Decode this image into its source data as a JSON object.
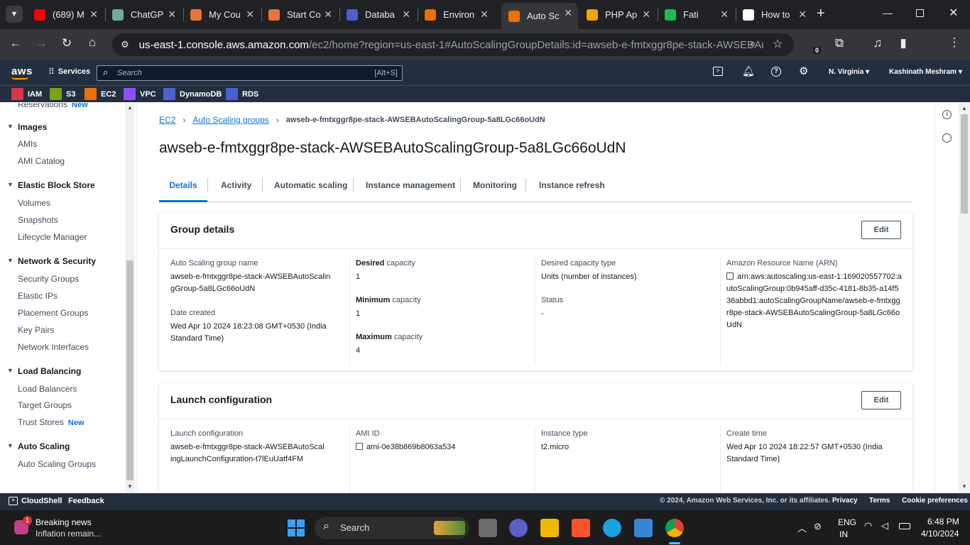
{
  "browser": {
    "tabs": [
      {
        "label": "(689) M",
        "icon": "youtube-icon",
        "color": "#ff0000"
      },
      {
        "label": "ChatGP",
        "icon": "chatgpt-icon",
        "color": "#74aa9c"
      },
      {
        "label": "My Cou",
        "icon": "course-icon",
        "color": "#e8743b"
      },
      {
        "label": "Start Co",
        "icon": "course-icon",
        "color": "#e8743b"
      },
      {
        "label": "Databa",
        "icon": "database-icon",
        "color": "#4b61d1"
      },
      {
        "label": "Environ",
        "icon": "aws-beanstalk-icon",
        "color": "#ed7100"
      },
      {
        "label": "Auto Sc",
        "icon": "aws-ec2-icon",
        "color": "#ed7100"
      },
      {
        "label": "PHP Ap",
        "icon": "package-icon",
        "color": "#f0a30a"
      },
      {
        "label": "Fati",
        "icon": "spotify-icon",
        "color": "#1db954"
      },
      {
        "label": "How to",
        "icon": "medium-icon",
        "color": "#ffffff"
      }
    ],
    "url_host": "us-east-1.console.aws.amazon.com",
    "url_path": "/ec2/home?region=us-east-1#AutoScalingGroupDetails:id=awseb-e-fmtxggr8pe-stack-AWSEBAutoSc...",
    "extensions_badge": "0"
  },
  "aws": {
    "logo": "aws",
    "services_label": "Services",
    "search_placeholder": "Search",
    "search_shortcut": "[Alt+S]",
    "region": "N. Virginia",
    "user": "Kashinath Meshram",
    "favorites": [
      {
        "label": "IAM",
        "color": "#dd344c"
      },
      {
        "label": "S3",
        "color": "#7aa116"
      },
      {
        "label": "EC2",
        "color": "#ed7100"
      },
      {
        "label": "VPC",
        "color": "#8c4fff"
      },
      {
        "label": "DynamoDB",
        "color": "#4b61d1"
      },
      {
        "label": "RDS",
        "color": "#4b61d1"
      }
    ]
  },
  "sidebar": {
    "partial_item": "Reservations",
    "partial_new": "New",
    "sections": [
      {
        "title": "Images",
        "items": [
          "AMIs",
          "AMI Catalog"
        ]
      },
      {
        "title": "Elastic Block Store",
        "items": [
          "Volumes",
          "Snapshots",
          "Lifecycle Manager"
        ]
      },
      {
        "title": "Network & Security",
        "items": [
          "Security Groups",
          "Elastic IPs",
          "Placement Groups",
          "Key Pairs",
          "Network Interfaces"
        ]
      },
      {
        "title": "Load Balancing",
        "items": [
          "Load Balancers",
          "Target Groups",
          "Trust Stores"
        ]
      },
      {
        "title": "Auto Scaling",
        "items": [
          "Auto Scaling Groups"
        ]
      }
    ],
    "new_badge": "New"
  },
  "breadcrumb": {
    "ec2": "EC2",
    "asg": "Auto Scaling groups",
    "current": "awseb-e-fmtxggr8pe-stack-AWSEBAutoScalingGroup-5a8LGc66oUdN"
  },
  "page_title": "awseb-e-fmtxggr8pe-stack-AWSEBAutoScalingGroup-5a8LGc66oUdN",
  "tabs": [
    "Details",
    "Activity",
    "Automatic scaling",
    "Instance management",
    "Monitoring",
    "Instance refresh"
  ],
  "group_details": {
    "title": "Group details",
    "edit": "Edit",
    "name_label": "Auto Scaling group name",
    "name_value": "awseb-e-fmtxggr8pe-stack-AWSEBAutoScalingGroup-5a8LGc66oUdN",
    "date_label": "Date created",
    "date_value": "Wed Apr 10 2024 18:23:08 GMT+0530 (India Standard Time)",
    "desired_bold": "Desired",
    "capacity_word": "capacity",
    "desired_value": "1",
    "minimum_bold": "Minimum",
    "minimum_value": "1",
    "maximum_bold": "Maximum",
    "maximum_value": "4",
    "type_label": "Desired capacity type",
    "type_value": "Units (number of instances)",
    "status_label": "Status",
    "status_value": "-",
    "arn_label": "Amazon Resource Name (ARN)",
    "arn_value": "arn:aws:autoscaling:us-east-1:169020557702:autoScalingGroup:0b945aff-d35c-4181-8b35-a14f536abbd1:autoScalingGroupName/awseb-e-fmtxggr8pe-stack-AWSEBAutoScalingGroup-5a8LGc66oUdN"
  },
  "launch_config": {
    "title": "Launch configuration",
    "edit": "Edit",
    "lc_label": "Launch configuration",
    "lc_value": "awseb-e-fmtxggr8pe-stack-AWSEBAutoScalingLaunchConfiguration-t7lEuUatf4FM",
    "ami_label": "AMI ID",
    "ami_value": "ami-0e38b869b8063a534",
    "type_label": "Instance type",
    "type_value": "t2.micro",
    "create_label": "Create time",
    "create_value": "Wed Apr 10 2024 18:22:57 GMT+0530 (India Standard Time)"
  },
  "footer": {
    "cloudshell": "CloudShell",
    "feedback": "Feedback",
    "copyright": "© 2024, Amazon Web Services, Inc. or its affiliates.",
    "privacy": "Privacy",
    "terms": "Terms",
    "cookies": "Cookie preferences"
  },
  "taskbar": {
    "news_title": "Breaking news",
    "news_sub": "Inflation remain...",
    "news_badge": "1",
    "search": "Search",
    "lang1": "ENG",
    "lang2": "IN",
    "time": "6:48 PM",
    "date": "4/10/2024"
  }
}
